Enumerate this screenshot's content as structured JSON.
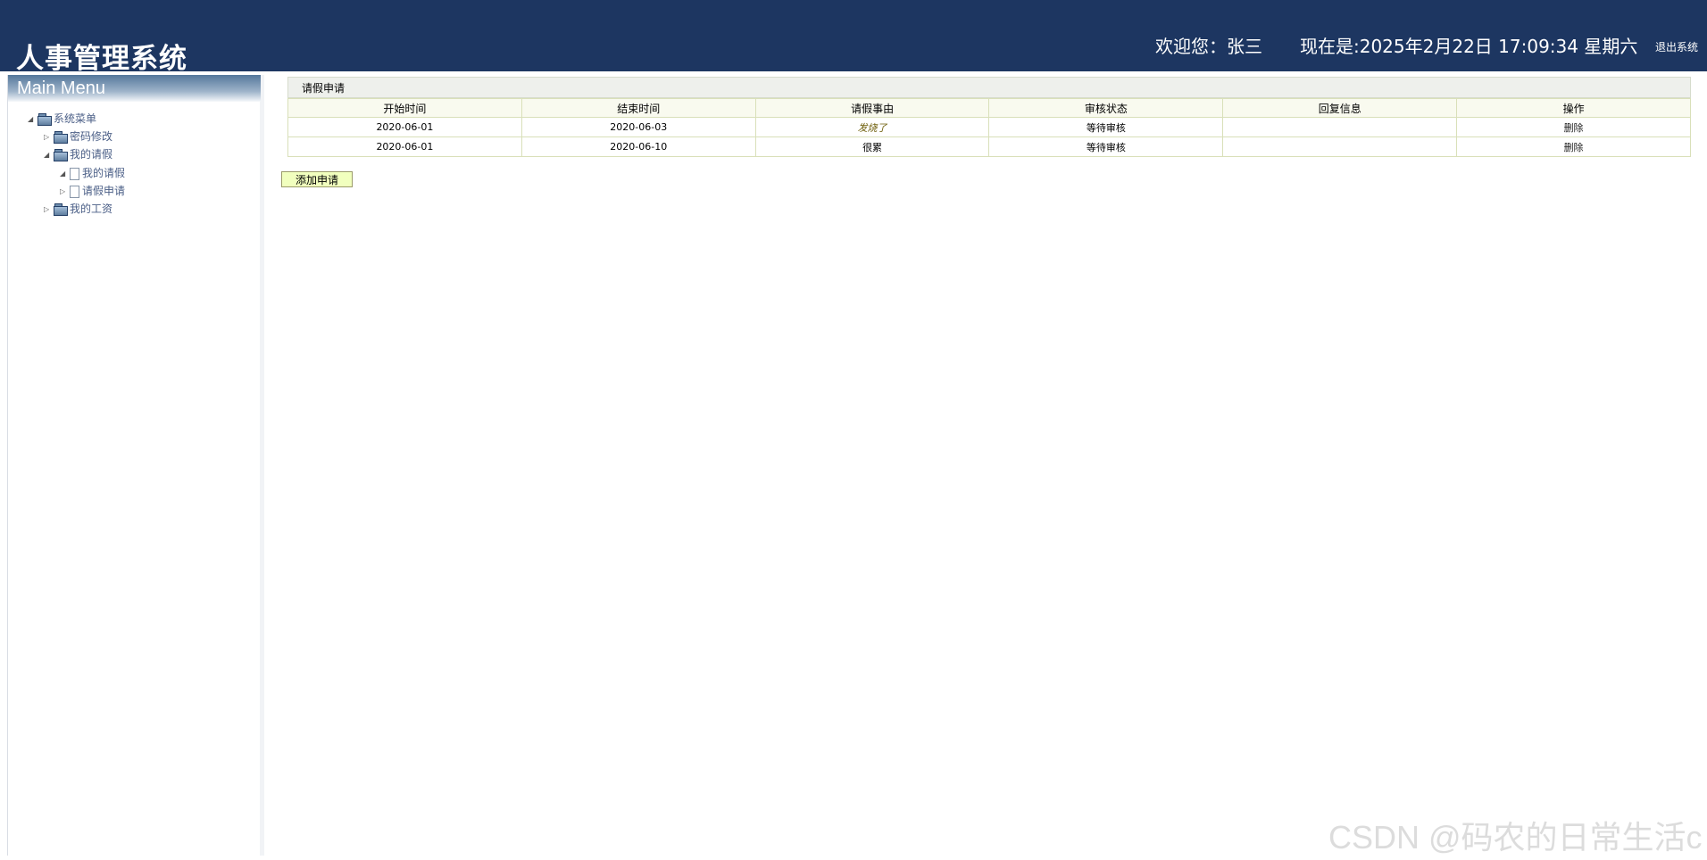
{
  "header": {
    "title": "人事管理系统",
    "welcome": "欢迎您：张三",
    "datetime": "现在是:2025年2月22日 17:09:34 星期六",
    "logout_label": "退出系统",
    "background": "#1d3661"
  },
  "sidebar": {
    "header": "Main Menu",
    "items": [
      {
        "label": "系统菜单",
        "icon": "folder-icon",
        "arrow": "◢"
      },
      {
        "label": "密码修改",
        "icon": "folder-icon",
        "arrow": "▷"
      },
      {
        "label": "我的请假",
        "icon": "folder-icon",
        "arrow": "◢"
      },
      {
        "label": "我的请假",
        "icon": "file-icon",
        "arrow": "◢"
      },
      {
        "label": "请假申请",
        "icon": "file-icon",
        "arrow": "▷"
      },
      {
        "label": "我的工资",
        "icon": "folder-icon",
        "arrow": "▷"
      }
    ]
  },
  "main": {
    "panel_title": "请假申请",
    "columns": [
      "开始时间",
      "结束时间",
      "请假事由",
      "审核状态",
      "回复信息",
      "操作"
    ],
    "rows": [
      {
        "start": "2020-06-01",
        "end": "2020-06-03",
        "reason": "发烧了",
        "status": "等待审核",
        "reply": "",
        "action": "删除"
      },
      {
        "start": "2020-06-01",
        "end": "2020-06-10",
        "reason": "很累",
        "status": "等待审核",
        "reply": "",
        "action": "删除"
      }
    ],
    "add_button": "添加申请"
  },
  "watermark": "CSDN @码农的日常生活c"
}
